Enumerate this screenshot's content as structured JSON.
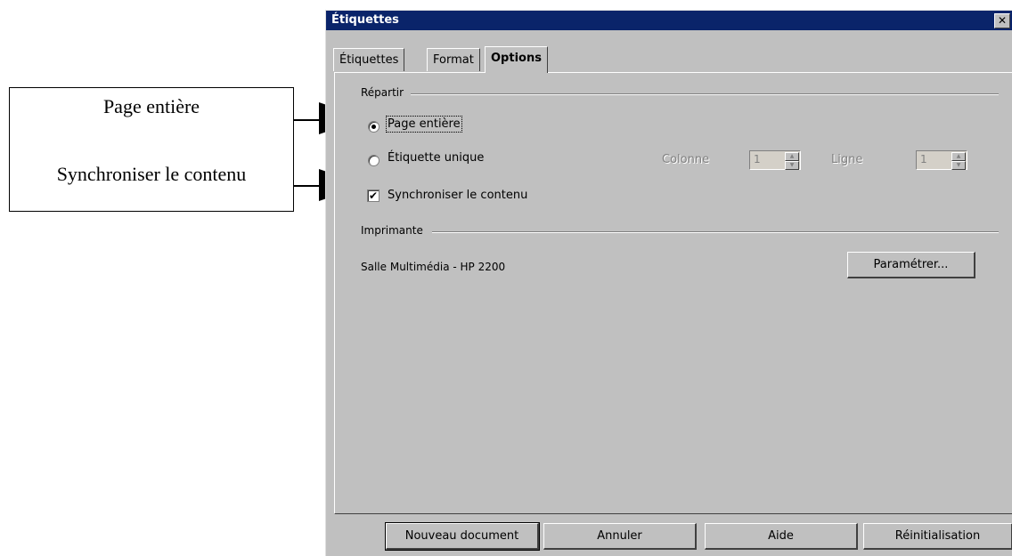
{
  "callout": {
    "line1": "Page entière",
    "line2": "Synchroniser le contenu"
  },
  "dialog": {
    "title": "Étiquettes",
    "close_symbol": "✕",
    "tabs": [
      {
        "label": "Étiquettes",
        "active": false
      },
      {
        "label": "Format",
        "active": false
      },
      {
        "label": "Options",
        "active": true
      }
    ],
    "repartir": {
      "label": "Répartir",
      "page_entiere": {
        "label": "Page entière",
        "selected": true
      },
      "etiquette_unique": {
        "label": "Étiquette unique",
        "selected": false
      },
      "colonne": {
        "label": "Colonne",
        "value": "1"
      },
      "ligne": {
        "label": "Ligne",
        "value": "1"
      },
      "synchroniser": {
        "label": "Synchroniser le contenu",
        "checked": true
      }
    },
    "imprimante": {
      "label": "Imprimante",
      "printer_name": "Salle Multimédia - HP  2200",
      "configure_button": "Paramétrer..."
    },
    "buttons": {
      "new_document": "Nouveau document",
      "cancel": "Annuler",
      "help": "Aide",
      "reset": "Réinitialisation"
    }
  }
}
